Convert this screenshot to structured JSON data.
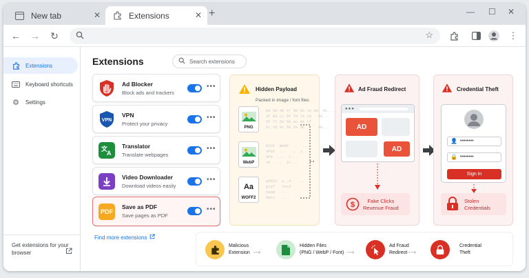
{
  "browser": {
    "tabs": [
      {
        "label": "New tab"
      },
      {
        "label": "Extensions"
      }
    ]
  },
  "sidebar": {
    "items": [
      {
        "label": "Extensions"
      },
      {
        "label": "Keyboard shortcuts"
      },
      {
        "label": "Settings"
      }
    ],
    "get_more": "Get extensions for your browser"
  },
  "main": {
    "title": "Extensions",
    "search_placeholder": "Search extensions",
    "find_more": "Find more extensions",
    "extensions": [
      {
        "name": "Ad Blocker",
        "desc": "Block ads and trackers",
        "color": "#d93025",
        "enabled": true
      },
      {
        "name": "VPN",
        "desc": "Protect your privacy",
        "color": "#1a56b0",
        "enabled": true
      },
      {
        "name": "Translator",
        "desc": "Translate webpages",
        "color": "#1e8e3e",
        "enabled": true
      },
      {
        "name": "Video Downloader",
        "desc": "Download videos easily",
        "color": "#7b3fc4",
        "enabled": true
      },
      {
        "name": "Save as PDF",
        "desc": "Save pages as PDF",
        "color": "#f6a821",
        "enabled": true
      }
    ]
  },
  "payload": {
    "title": "Hidden Payload",
    "subtitle": "Packed in image / font files",
    "files": [
      "PNG",
      "WebP",
      "WOFF2"
    ],
    "file_glyph": "Aa",
    "hex_lines": [
      "89 50 4E 47 0D 0A 1A 0A  4E...\n3f 89 c1 9f 7d 7a 26   6E...\n6f 77 50 6b ac 9e 1f\n5c 35 0c 56 20 3b      4E...",
      "RIFF  WEBP  ..  ...\nVP8X  ...  ..  J...\nVP8  ...  /...\nc8  ...  2/...",
      "wOFF2  1..4    ..\nglyf   1oc2\nhead   ...\nhmtx   ..."
    ]
  },
  "adfraud": {
    "title": "Ad Fraud Redirect",
    "ad_label": "AD",
    "result": "Fake Clicks\nRevenue Fraud"
  },
  "credential": {
    "title": "Credential Theft",
    "password_mask": "••••••••",
    "signin": "Sign in",
    "result": "Stolen\nCredentials"
  },
  "flow": [
    {
      "label": "Malicious\nExtension",
      "color": "#f9c74f"
    },
    {
      "label": "Hidden Files\n(PNG / WebP / Font)",
      "color": "#cdebd3"
    },
    {
      "label": "Ad Fraud\nRedirect",
      "color": "#d93025"
    },
    {
      "label": "Credential\nTheft",
      "color": "#d93025"
    }
  ]
}
